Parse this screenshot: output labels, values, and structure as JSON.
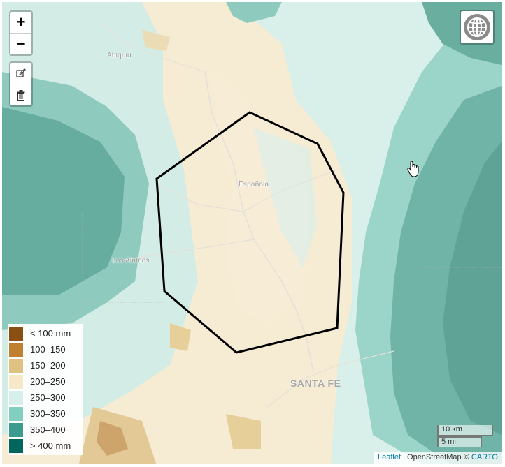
{
  "map": {
    "place_labels": {
      "abiquiu": "Abiquiu",
      "espanola": "Española",
      "los_alamos": "Los Alamos",
      "santa_fe": "SANTA FE"
    },
    "zoom": {
      "in_label": "+",
      "out_label": "−"
    },
    "draw_tools": {
      "edit_icon": "edit-icon",
      "delete_icon": "trash-icon"
    },
    "basemap_button_icon": "globe-icon",
    "legend": {
      "items": [
        {
          "label": "< 100 mm",
          "color": "#8a4f12"
        },
        {
          "label": "100–150",
          "color": "#c08032"
        },
        {
          "label": "150–200",
          "color": "#dfc282"
        },
        {
          "label": "200–250",
          "color": "#f6e8c8"
        },
        {
          "label": "250–300",
          "color": "#d6efea"
        },
        {
          "label": "300–350",
          "color": "#82cfc0"
        },
        {
          "label": "350–400",
          "color": "#3c9b8f"
        },
        {
          "label": "> 400 mm",
          "color": "#02665c"
        }
      ]
    },
    "scale": {
      "km": "10 km",
      "mi": "5 mi"
    },
    "attribution": {
      "leaflet": "Leaflet",
      "separator": " | ",
      "osm": "OpenStreetMap © ",
      "carto": "CARTO"
    }
  }
}
